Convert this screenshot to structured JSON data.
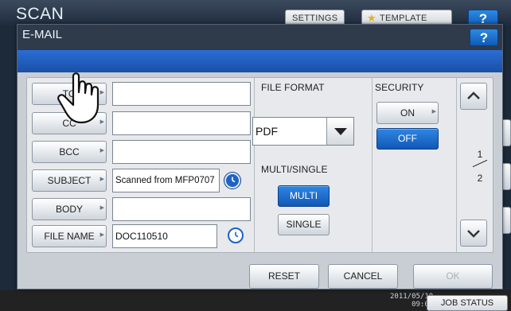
{
  "background": {
    "title": "SCAN",
    "settings_label": "SETTINGS",
    "template_label": "TEMPLATE",
    "help_label": "?",
    "datetime": "2011/05/10\n09:07",
    "job_status_label": "JOB STATUS"
  },
  "dialog": {
    "title": "E-MAIL",
    "help_label": "?"
  },
  "fields": {
    "to_label": "TO",
    "to_value": "",
    "cc_label": "CC",
    "cc_value": "",
    "bcc_label": "BCC",
    "bcc_value": "",
    "subject_label": "SUBJECT",
    "subject_value": "Scanned from MFP0707",
    "body_label": "BODY",
    "body_value": "",
    "filename_label": "FILE NAME",
    "filename_value": "DOC110510"
  },
  "file_format": {
    "heading": "FILE FORMAT",
    "selected": "PDF"
  },
  "multi_single": {
    "heading": "MULTI/SINGLE",
    "multi_label": "MULTI",
    "single_label": "SINGLE",
    "selected": "MULTI"
  },
  "security": {
    "heading": "SECURITY",
    "on_label": "ON",
    "off_label": "OFF",
    "selected": "OFF"
  },
  "pager": {
    "current": "1",
    "total": "2"
  },
  "actions": {
    "reset_label": "RESET",
    "cancel_label": "CANCEL",
    "ok_label": "OK"
  },
  "colors": {
    "accent_blue": "#1f6fd8",
    "dialog_header": "#2f3b4b"
  }
}
